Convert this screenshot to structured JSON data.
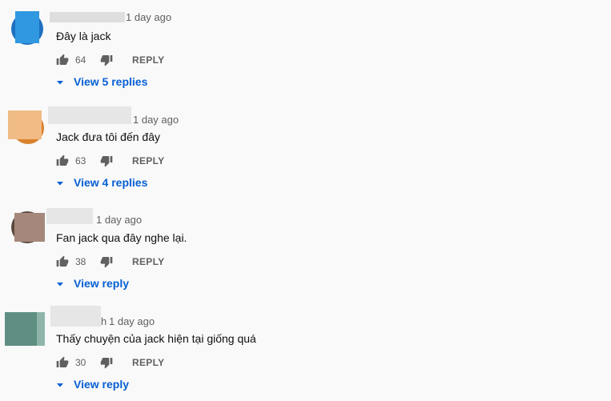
{
  "comments": [
    {
      "name_suffix": "",
      "time": "1 day ago",
      "text": "Đây là jack",
      "likes": "64",
      "reply_label": "REPLY",
      "replies_label": "View 5 replies"
    },
    {
      "name_suffix": "",
      "time": "1 day ago",
      "text": "Jack đưa tôi đến đây",
      "likes": "63",
      "reply_label": "REPLY",
      "replies_label": "View 4 replies"
    },
    {
      "name_suffix": "",
      "time": "1 day ago",
      "text": "Fan jack qua đây nghe lại.",
      "likes": "38",
      "reply_label": "REPLY",
      "replies_label": "View reply"
    },
    {
      "name_suffix": "h",
      "time": "1 day ago",
      "text": "Thấy chuyện của jack hiện tại giống quá",
      "likes": "30",
      "reply_label": "REPLY",
      "replies_label": "View reply"
    }
  ],
  "icons": {
    "like": "thumb-up-icon",
    "dislike": "thumb-down-icon",
    "expand": "triangle-down-icon"
  },
  "colors": {
    "link": "#065fd4",
    "meta": "#606060",
    "text": "#0f0f0f"
  }
}
